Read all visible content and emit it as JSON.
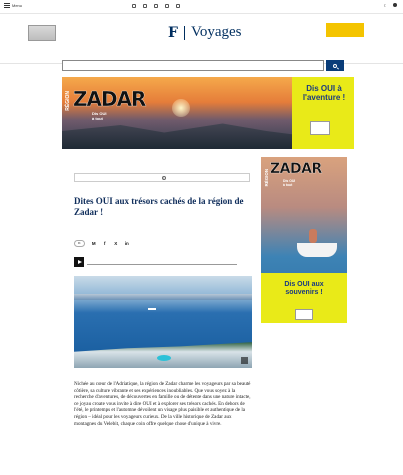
{
  "topbar": {
    "menu_label": "Menu",
    "links": [
      {
        "icon": "tv-icon",
        "label": ""
      },
      {
        "icon": "headphones-icon",
        "label": ""
      },
      {
        "icon": "globe-icon",
        "label": ""
      },
      {
        "icon": "mail-icon",
        "label": ""
      },
      {
        "icon": "app-icon",
        "label": ""
      }
    ],
    "account_label": ""
  },
  "header": {
    "print_label": "",
    "logo_mark": "F",
    "logo_text": "Voyages",
    "cta_title": "",
    "cta_sub": ""
  },
  "nav": [],
  "search": {
    "placeholder": ""
  },
  "hero_ad": {
    "region": "RÉGION",
    "brand": "ZADAR",
    "tagline_line1": "Dis OUI",
    "tagline_line2": "à tout",
    "headline": "Dis OUI à l'aventure !",
    "badge": ""
  },
  "breadcrumb": "",
  "article": {
    "sponsor_note": "",
    "title": "Dites OUI aux trésors cachés de la région de Zadar !",
    "byline": "",
    "date": "",
    "copy_link": "",
    "share_icons": [
      "M",
      "f",
      "X",
      "in"
    ],
    "audio_title": "",
    "audio_time": "",
    "photo_caption": "",
    "lead": "Nichée au cœur de l'Adriatique, la région de Zadar charme les voyageurs par sa beauté côtière, sa culture vibrante et ses expériences inoubliables. Que vous soyez à la recherche d'aventures, de découvertes en famille ou de détente dans une nature intacte, ce joyau croate vous invite à dire OUI et à explorer ses trésors cachés. En dehors de l'été, le printemps et l'automne dévoilent un visage plus paisible et authentique de la région – idéal pour les voyageurs curieux. De la ville historique de Zadar aux montagnes du Velebit, chaque coin offre quelque chose d'unique à vivre."
  },
  "side_ad": {
    "region": "RÉGION",
    "brand": "ZADAR",
    "tagline_line1": "Dis OUI",
    "tagline_line2": "à tout",
    "headline": "Dis OUI aux souvenirs !",
    "badge": ""
  },
  "colors": {
    "brand_navy": "#002e5f",
    "cta_yellow": "#f4c400",
    "ad_yellow": "#e9ea18",
    "search_button": "#0a3d79"
  }
}
